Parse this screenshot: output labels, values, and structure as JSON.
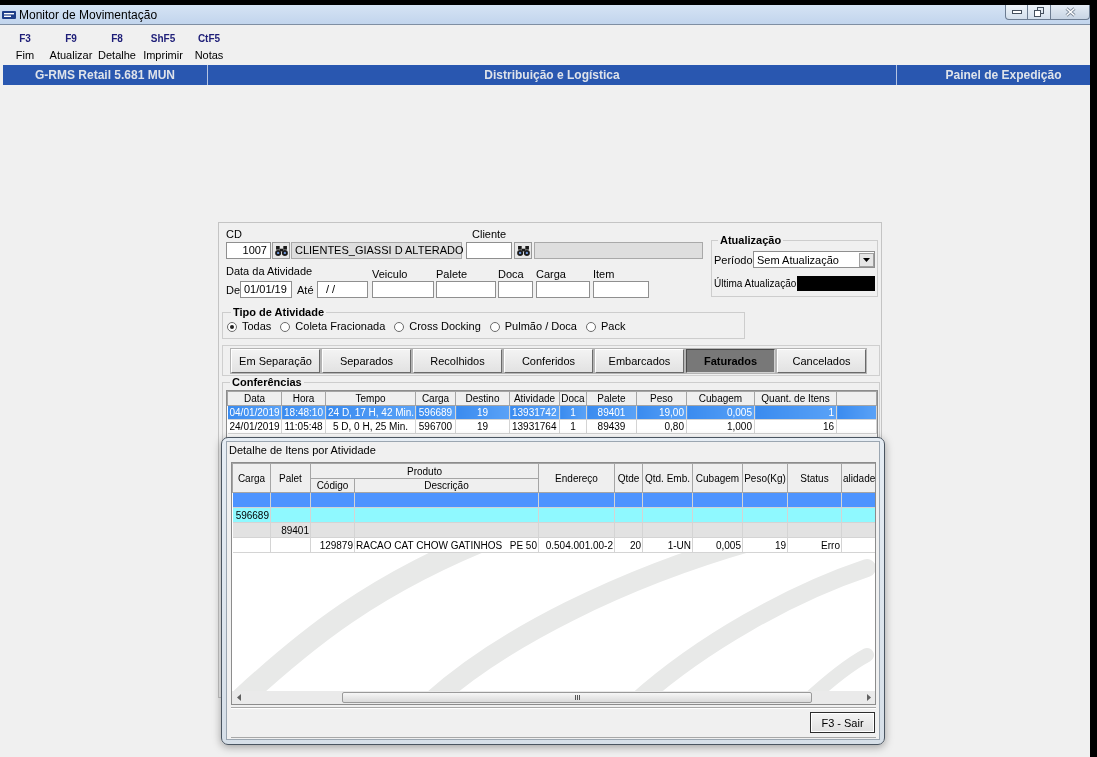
{
  "window": {
    "title": "Monitor de Movimentação"
  },
  "toolbar": [
    {
      "key": "F3",
      "label": "Fim"
    },
    {
      "key": "F9",
      "label": "Atualizar"
    },
    {
      "key": "F8",
      "label": "Detalhe"
    },
    {
      "key": "ShF5",
      "label": "Imprimir"
    },
    {
      "key": "CtF5",
      "label": "Notas"
    }
  ],
  "header_bar": [
    "G-RMS Retail 5.681 MUN",
    "Distribuição e Logística",
    "Painel de Expedição"
  ],
  "filters": {
    "cd": {
      "label": "CD",
      "value": "1007",
      "description": "CLIENTES_GIASSI D ALTERADO"
    },
    "cliente": {
      "label": "Cliente"
    },
    "data_atividade": {
      "label": "Data da Atividade",
      "de_label": "De",
      "de_value": "01/01/19",
      "ate_label": "Até",
      "ate_value": "/ /"
    },
    "fields": [
      {
        "label": "Veiculo"
      },
      {
        "label": "Palete"
      },
      {
        "label": "Doca"
      },
      {
        "label": "Carga"
      },
      {
        "label": "Item"
      }
    ]
  },
  "atualizacao": {
    "title": "Atualização",
    "periodo_label": "Período",
    "periodo_value": "Sem Atualização",
    "ultima_label": "Última Atualização"
  },
  "tipo_atividade": {
    "title": "Tipo de Atividade",
    "options": [
      {
        "label": "Todas",
        "selected": true
      },
      {
        "label": "Coleta Fracionada",
        "selected": false
      },
      {
        "label": "Cross Docking",
        "selected": false
      },
      {
        "label": "Pulmão / Doca",
        "selected": false
      },
      {
        "label": "Pack",
        "selected": false
      }
    ]
  },
  "status_tabs": [
    {
      "label": "Em Separação",
      "selected": false
    },
    {
      "label": "Separados",
      "selected": false
    },
    {
      "label": "Recolhidos",
      "selected": false
    },
    {
      "label": "Conferidos",
      "selected": false
    },
    {
      "label": "Embarcados",
      "selected": false
    },
    {
      "label": "Faturados",
      "selected": true
    },
    {
      "label": "Cancelados",
      "selected": false
    }
  ],
  "conferencias": {
    "title": "Conferências",
    "columns": [
      "Data",
      "Hora",
      "Tempo",
      "Carga",
      "Destino",
      "Atividade",
      "Doca",
      "Palete",
      "Peso",
      "Cubagem",
      "Quant. de Itens"
    ],
    "rows": [
      {
        "selected": true,
        "cells": [
          "04/01/2019",
          "18:48:10",
          "24 D, 17 H, 42 Min.",
          "596689",
          "19",
          "13931742",
          "1",
          "89401",
          "19,00",
          "0,005",
          "1"
        ]
      },
      {
        "selected": false,
        "cells": [
          "24/01/2019",
          "11:05:48",
          "5 D, 0 H, 25 Min.",
          "596700",
          "19",
          "13931764",
          "1",
          "89439",
          "0,80",
          "1,000",
          "16"
        ]
      }
    ]
  },
  "dialog": {
    "title": "Detalhe de Itens por Atividade",
    "group_header": "Produto",
    "columns": [
      "Carga",
      "Palet",
      "Código",
      "Descrição",
      "Endereço",
      "Qtde",
      "Qtd. Emb.",
      "Cubagem",
      "Peso(Kg)",
      "Status",
      "alidade"
    ],
    "rows": [
      {
        "kind": "activity",
        "selected": true
      },
      {
        "kind": "carga",
        "selected": false,
        "carga": "596689"
      },
      {
        "kind": "palete",
        "selected": false,
        "palet": "89401"
      },
      {
        "kind": "item",
        "selected": false,
        "codigo": "129879",
        "descricao": [
          "RACAO CAT CHOW GATINHOS",
          "PE 50"
        ],
        "endereco": "0.504.001.00-2",
        "qtde": "20",
        "qtd_emb": "1-UN",
        "cubagem": "0,005",
        "peso": "19",
        "status": "Erro"
      }
    ],
    "close_button": "F3 - Sair"
  }
}
